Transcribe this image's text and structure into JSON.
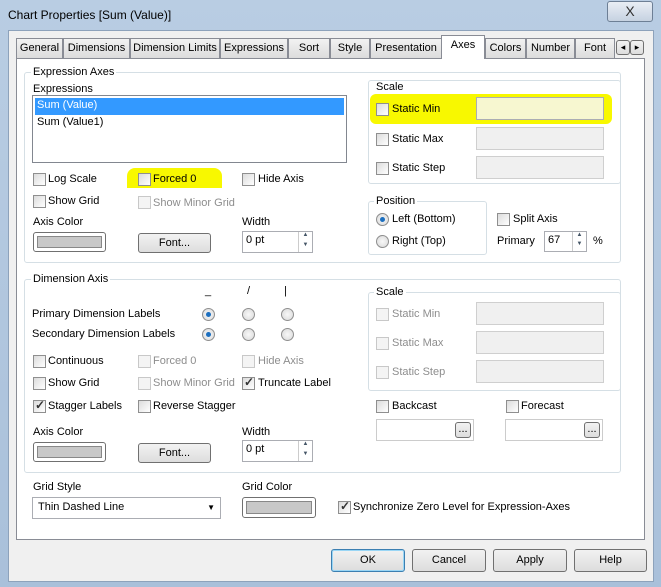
{
  "window": {
    "title": "Chart Properties [Sum (Value)]",
    "close": "X"
  },
  "tabs": [
    "General",
    "Dimensions",
    "Dimension Limits",
    "Expressions",
    "Sort",
    "Style",
    "Presentation",
    "Axes",
    "Colors",
    "Number",
    "Font"
  ],
  "tab_scroll": {
    "left": "◂",
    "right": "▸"
  },
  "expression_axes": {
    "legend": "Expression Axes",
    "expressions_label": "Expressions",
    "expressions": [
      "Sum (Value)",
      "Sum (Value1)"
    ],
    "log_scale": "Log Scale",
    "forced0": "Forced 0",
    "hide_axis": "Hide Axis",
    "show_grid": "Show Grid",
    "show_minor_grid": "Show Minor Grid",
    "axis_color": "Axis Color",
    "font_button": "Font...",
    "width_label": "Width",
    "width_value": "0 pt",
    "scale": {
      "legend": "Scale",
      "static_min": "Static Min",
      "static_max": "Static Max",
      "static_step": "Static Step"
    },
    "position": {
      "legend": "Position",
      "left": "Left (Bottom)",
      "right": "Right (Top)",
      "selected": "Left (Bottom)"
    },
    "split_axis": "Split Axis",
    "primary_label": "Primary",
    "primary_value": "67",
    "percent": "%"
  },
  "dimension_axis": {
    "legend": "Dimension Axis",
    "orient_headers": [
      "_",
      "/",
      "|"
    ],
    "primary_labels": "Primary Dimension Labels",
    "secondary_labels": "Secondary Dimension Labels",
    "continuous": "Continuous",
    "forced0": "Forced 0",
    "hide_axis": "Hide Axis",
    "show_grid": "Show Grid",
    "show_minor_grid": "Show Minor Grid",
    "truncate_label": "Truncate Label",
    "stagger_labels": "Stagger Labels",
    "reverse_stagger": "Reverse Stagger",
    "axis_color": "Axis Color",
    "font_button": "Font...",
    "width_label": "Width",
    "width_value": "0 pt",
    "scale": {
      "legend": "Scale",
      "static_min": "Static Min",
      "static_max": "Static Max",
      "static_step": "Static Step"
    },
    "backcast": "Backcast",
    "forecast": "Forecast",
    "ellipsis": "..."
  },
  "grid": {
    "style_label": "Grid Style",
    "style_value": "Thin Dashed Line",
    "color_label": "Grid Color",
    "sync_zero": "Synchronize Zero Level for Expression-Axes"
  },
  "buttons": {
    "ok": "OK",
    "cancel": "Cancel",
    "apply": "Apply",
    "help": "Help"
  },
  "colors": {
    "highlight": "#f8f800",
    "selection": "#3399ff",
    "axis_color": "#c8c8c8"
  }
}
